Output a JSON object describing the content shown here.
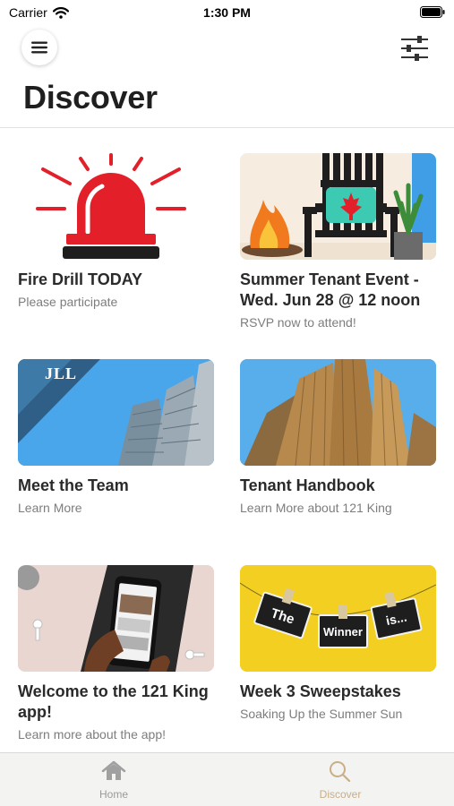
{
  "status_bar": {
    "carrier": "Carrier",
    "time": "1:30 PM"
  },
  "header": {
    "title": "Discover",
    "menu_icon": "hamburger-menu-icon",
    "filter_icon": "filter-sliders-icon"
  },
  "cards": [
    {
      "title": "Fire Drill TODAY",
      "subtitle": "Please participate",
      "image": "red-alarm-siren"
    },
    {
      "title": "Summer Tenant Event - Wed. Jun 28 @ 12 noon",
      "subtitle": "RSVP now to attend!",
      "image": "muskoka-chair-campfire"
    },
    {
      "title": "Meet the Team",
      "subtitle": "Learn More",
      "image": "jll-office-towers",
      "logo_text": "JLL"
    },
    {
      "title": "Tenant Handbook",
      "subtitle": "Learn More about 121 King",
      "image": "gold-skyscrapers"
    },
    {
      "title": "Welcome to the 121 King app!",
      "subtitle": "Learn more about the app!",
      "image": "hand-holding-phone"
    },
    {
      "title": "Week 3 Sweepstakes",
      "subtitle": "Soaking Up the Summer Sun",
      "image": "the-winner-is-signs",
      "sign_texts": [
        "The",
        "Winner",
        "is..."
      ]
    }
  ],
  "tabbar": {
    "tabs": [
      {
        "label": "Home",
        "icon": "home-icon",
        "active": false
      },
      {
        "label": "Discover",
        "icon": "search-icon",
        "active": true
      }
    ],
    "active_color": "#c9ae86",
    "inactive_color": "#9a9a9a"
  },
  "colors": {
    "alarm_red": "#e3202a",
    "sweepstakes_yellow": "#f3cf22",
    "sky_blue": "#3f9ee6"
  }
}
